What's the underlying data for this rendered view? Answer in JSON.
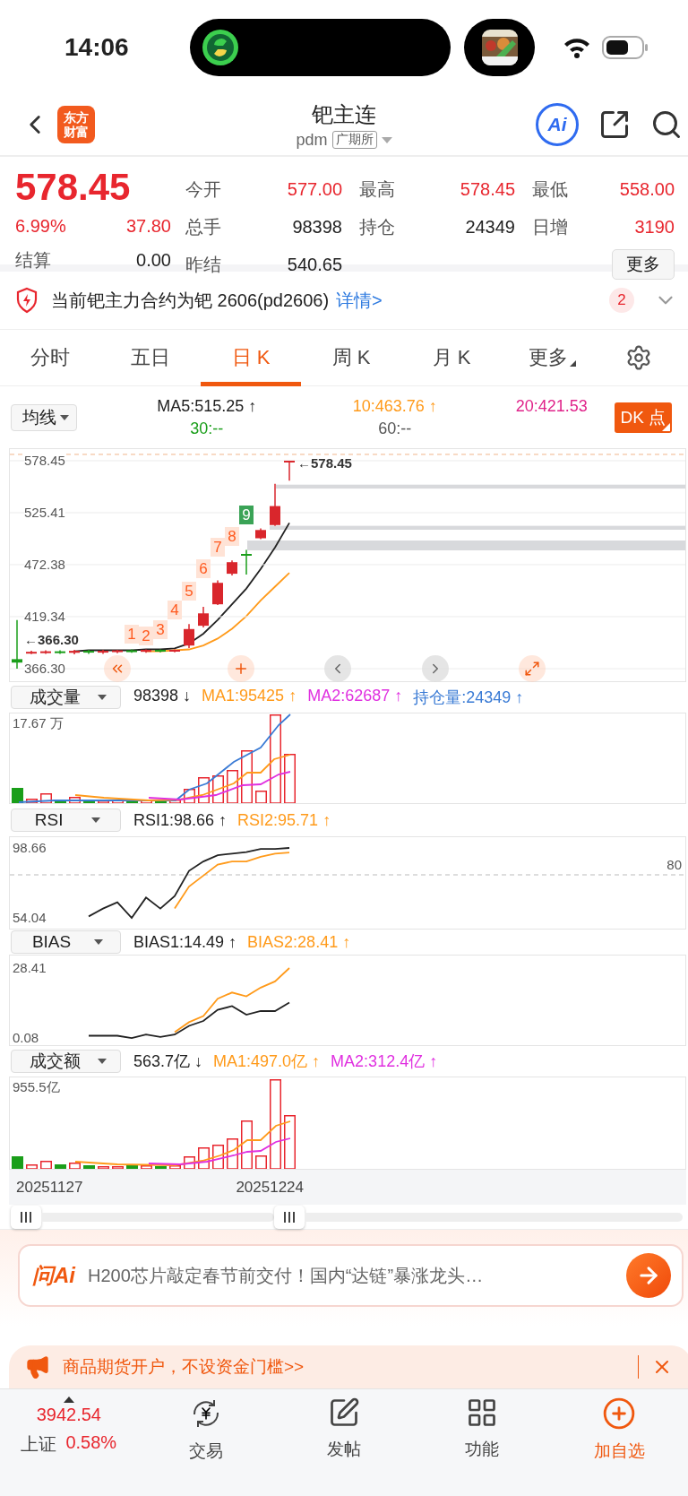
{
  "status_bar": {
    "time": "14:06"
  },
  "header": {
    "logo": [
      "东方",
      "财富"
    ],
    "title": "钯主连",
    "code": "pdm",
    "exchange": "广期所",
    "ai_label": "Ai"
  },
  "quote": {
    "price": "578.45",
    "change_pct": "6.99%",
    "change": "37.80",
    "settle_label": "结算",
    "settle": "0.00",
    "fields": [
      {
        "label": "今开",
        "value": "577.00",
        "color": "#e8262e"
      },
      {
        "label": "最高",
        "value": "578.45",
        "color": "#e8262e"
      },
      {
        "label": "最低",
        "value": "558.00",
        "color": "#e8262e"
      },
      {
        "label": "总手",
        "value": "98398",
        "color": "#222222"
      },
      {
        "label": "持仓",
        "value": "24349",
        "color": "#222222"
      },
      {
        "label": "日增",
        "value": "3190",
        "color": "#e8262e"
      },
      {
        "label": "昨结",
        "value": "540.65",
        "color": "#222222"
      }
    ],
    "more_button": "更多"
  },
  "notice": {
    "text": "当前钯主力合约为钯 2606(pd2606)",
    "link": "详情>",
    "badge": "2"
  },
  "period_tabs": [
    {
      "label": "分时",
      "selected": false
    },
    {
      "label": "五日",
      "selected": false
    },
    {
      "label": "日 K",
      "selected": true
    },
    {
      "label": "周 K",
      "selected": false
    },
    {
      "label": "月 K",
      "selected": false
    },
    {
      "label": "更多",
      "selected": false
    }
  ],
  "main_chart": {
    "indicator": "均线",
    "legend": [
      {
        "text": "MA5:515.25 ↑",
        "color": "#222222"
      },
      {
        "text": "10:463.76 ↑",
        "color": "#ff9a1a"
      },
      {
        "text": "20:421.53",
        "color": "#e0248a"
      },
      {
        "text": "30:--",
        "color": "#1a9e1a"
      },
      {
        "text": "60:--",
        "color": "#555555"
      }
    ],
    "dk_button": "DK 点",
    "high_marker": "←578.45",
    "low_marker": "←366.30",
    "signals": [
      {
        "label": "1",
        "color": "#ffe3d6"
      },
      {
        "label": "2",
        "color": "#ffe3d6"
      },
      {
        "label": "3",
        "color": "#ffe3d6"
      },
      {
        "label": "4",
        "color": "#ffe3d6"
      },
      {
        "label": "5",
        "color": "#ffe3d6"
      },
      {
        "label": "6",
        "color": "#ffe3d6"
      },
      {
        "label": "7",
        "color": "#ffe3d6"
      },
      {
        "label": "8",
        "color": "#ffe3d6"
      },
      {
        "label": "9",
        "color": "#3aa356"
      }
    ],
    "chart_data": {
      "type": "candlestick",
      "ylim": [
        353.5,
        590.3
      ],
      "grid": true,
      "yticks": [
        {
          "value": 578.45,
          "label": "578.45"
        },
        {
          "value": 525.41,
          "label": "525.41"
        },
        {
          "value": 472.38,
          "label": "472.38"
        },
        {
          "value": 419.34,
          "label": "419.34"
        },
        {
          "value": 366.3,
          "label": "366.30"
        }
      ],
      "ohlc": [
        [
          376.0,
          416.0,
          366.3,
          372.5
        ],
        [
          382.0,
          384.5,
          381.2,
          383.5
        ],
        [
          382.5,
          385.0,
          381.5,
          384.0
        ],
        [
          384.0,
          385.0,
          381.5,
          382.5
        ],
        [
          382.5,
          385.5,
          381.0,
          384.5
        ],
        [
          384.5,
          385.5,
          381.5,
          383.0
        ],
        [
          383.0,
          385.5,
          381.5,
          384.5
        ],
        [
          383.5,
          385.5,
          382.0,
          385.0
        ],
        [
          385.0,
          386.0,
          382.5,
          383.5
        ],
        [
          383.5,
          386.0,
          382.5,
          385.5
        ],
        [
          385.5,
          386.0,
          383.0,
          384.0
        ],
        [
          384.0,
          386.0,
          383.0,
          385.5
        ],
        [
          389.89,
          411.77,
          387.42,
          406.72
        ],
        [
          410.09,
          429.45,
          408.41,
          422.72
        ],
        [
          431.98,
          456.39,
          431.14,
          453.86
        ],
        [
          463.12,
          476.59,
          461.44,
          474.91
        ],
        [
          483.33,
          487.54,
          462.28,
          481.64
        ],
        [
          499.32,
          509.42,
          498.48,
          507.74
        ],
        [
          512.79,
          554.88,
          511.95,
          532.15
        ],
        [
          577.0,
          578.45,
          558.0,
          578.45
        ]
      ]
    }
  },
  "panels": [
    {
      "kind": "volume",
      "indicator": "成交量",
      "y_labels": [
        "17.67 万"
      ],
      "legend": [
        {
          "text": "98398 ↓",
          "color": "#222222"
        },
        {
          "text": "MA1:95425 ↑",
          "color": "#ff9a1a"
        },
        {
          "text": "MA2:62687 ↑",
          "color": "#e030e0"
        },
        {
          "text": "持仓量:24349 ↑",
          "color": "#3a7bd5"
        }
      ]
    },
    {
      "kind": "rsi",
      "indicator": "RSI",
      "legend": [
        {
          "text": "RSI1:98.66 ↑",
          "color": "#222222"
        },
        {
          "text": "RSI2:95.71 ↑",
          "color": "#ff9a1a"
        }
      ],
      "chart_data": {
        "type": "line",
        "ylim": [
          47.2,
          105.5
        ],
        "yticks": [
          {
            "value": 54.04,
            "label": "54.04"
          },
          {
            "value": 98.66,
            "label": "98.66"
          }
        ],
        "annotations": [
          "80"
        ],
        "series": [
          {
            "color": "#222222",
            "values": [
              null,
              null,
              null,
              null,
              null,
              55,
              60,
              64,
              54.04,
              67,
              60,
              68,
              84,
              90,
              94,
              95,
              96,
              98,
              98,
              98.66
            ]
          },
          {
            "color": "#ff9a1a",
            "values": [
              null,
              null,
              null,
              null,
              null,
              null,
              null,
              null,
              null,
              null,
              null,
              60,
              74,
              81,
              88,
              90,
              90,
              93,
              95,
              95.71
            ]
          }
        ]
      }
    },
    {
      "kind": "bias",
      "indicator": "BIAS",
      "legend": [
        {
          "text": "BIAS1:14.49 ↑",
          "color": "#222222"
        },
        {
          "text": "BIAS2:28.41 ↑",
          "color": "#ff9a1a"
        }
      ],
      "chart_data": {
        "type": "line",
        "ylim": [
          -2.8,
          33.5
        ],
        "yticks": [
          {
            "value": 0.08,
            "label": "0.08"
          },
          {
            "value": 28.41,
            "label": "28.41"
          }
        ],
        "series": [
          {
            "color": "#222222",
            "values": [
              null,
              null,
              null,
              null,
              null,
              1,
              1,
              1,
              0.08,
              1.5,
              0.5,
              1.5,
              5,
              7,
              11.5,
              13,
              9.5,
              11,
              11,
              14.49
            ]
          },
          {
            "color": "#ff9a1a",
            "values": [
              null,
              null,
              null,
              null,
              null,
              null,
              null,
              null,
              null,
              null,
              null,
              2.5,
              6.5,
              9,
              16,
              18.5,
              17,
              20.5,
              23,
              28.41
            ]
          }
        ]
      }
    },
    {
      "kind": "amount",
      "indicator": "成交额",
      "y_labels": [
        "955.5亿"
      ],
      "legend": [
        {
          "text": "563.7亿 ↓",
          "color": "#222222"
        },
        {
          "text": "MA1:497.0亿 ↑",
          "color": "#ff9a1a"
        },
        {
          "text": "MA2:312.4亿 ↑",
          "color": "#e030e0"
        }
      ]
    }
  ],
  "dates": [
    "20251127",
    "20251224"
  ],
  "ai_banner": {
    "logo": "问Ai",
    "text": "H200芯片敲定春节前交付！国内“达链”暴涨龙头…"
  },
  "ad": {
    "text": "商品期货开户，不设资金门槛>>"
  },
  "bottom_nav": {
    "index": {
      "value": "3942.54",
      "name": "上证",
      "change": "0.58%"
    },
    "items": [
      {
        "label": "交易",
        "kind": "trade"
      },
      {
        "label": "发帖",
        "kind": "post"
      },
      {
        "label": "功能",
        "kind": "apps"
      },
      {
        "label": "加自选",
        "kind": "add"
      }
    ]
  }
}
